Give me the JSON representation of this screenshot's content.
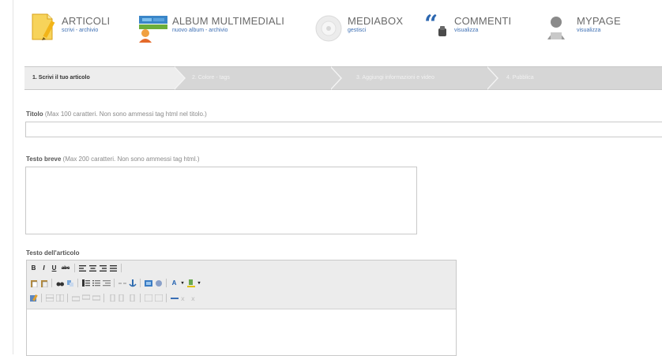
{
  "nav": {
    "articoli": {
      "title": "ARTICOLI",
      "sub": "scrivi - archivio"
    },
    "album": {
      "title": "ALBUM MULTIMEDIALI",
      "sub": "nuovo album - archivio"
    },
    "mediabox": {
      "title": "MEDIABOX",
      "sub": "gestisci"
    },
    "commenti": {
      "title": "COMMENTI",
      "sub": "visualizza"
    },
    "mypage": {
      "title": "MYPAGE",
      "sub": "visualizza"
    }
  },
  "steps": [
    {
      "label": "1. Scrivi il tuo articolo",
      "active": true
    },
    {
      "label": "2. Colore - tags",
      "active": false
    },
    {
      "label": "3. Aggiungi informazioni e video",
      "active": false
    },
    {
      "label": "4. Pubblica",
      "active": false
    }
  ],
  "form": {
    "titolo_label": "Titolo",
    "titolo_hint": " (Max 100 caratteri. Non sono ammessi tag html nel titolo.)",
    "titolo_value": "",
    "breve_label": "Testo breve",
    "breve_hint": " (Max 200 caratteri. Non sono ammessi tag html.)",
    "breve_value": "",
    "articolo_label": "Testo dell'articolo",
    "articolo_value": ""
  },
  "toolbar": {
    "bold": "B",
    "italic": "I",
    "underline": "U",
    "strike": "abc",
    "font_color": "A",
    "dropdown_arrow": "▾"
  }
}
